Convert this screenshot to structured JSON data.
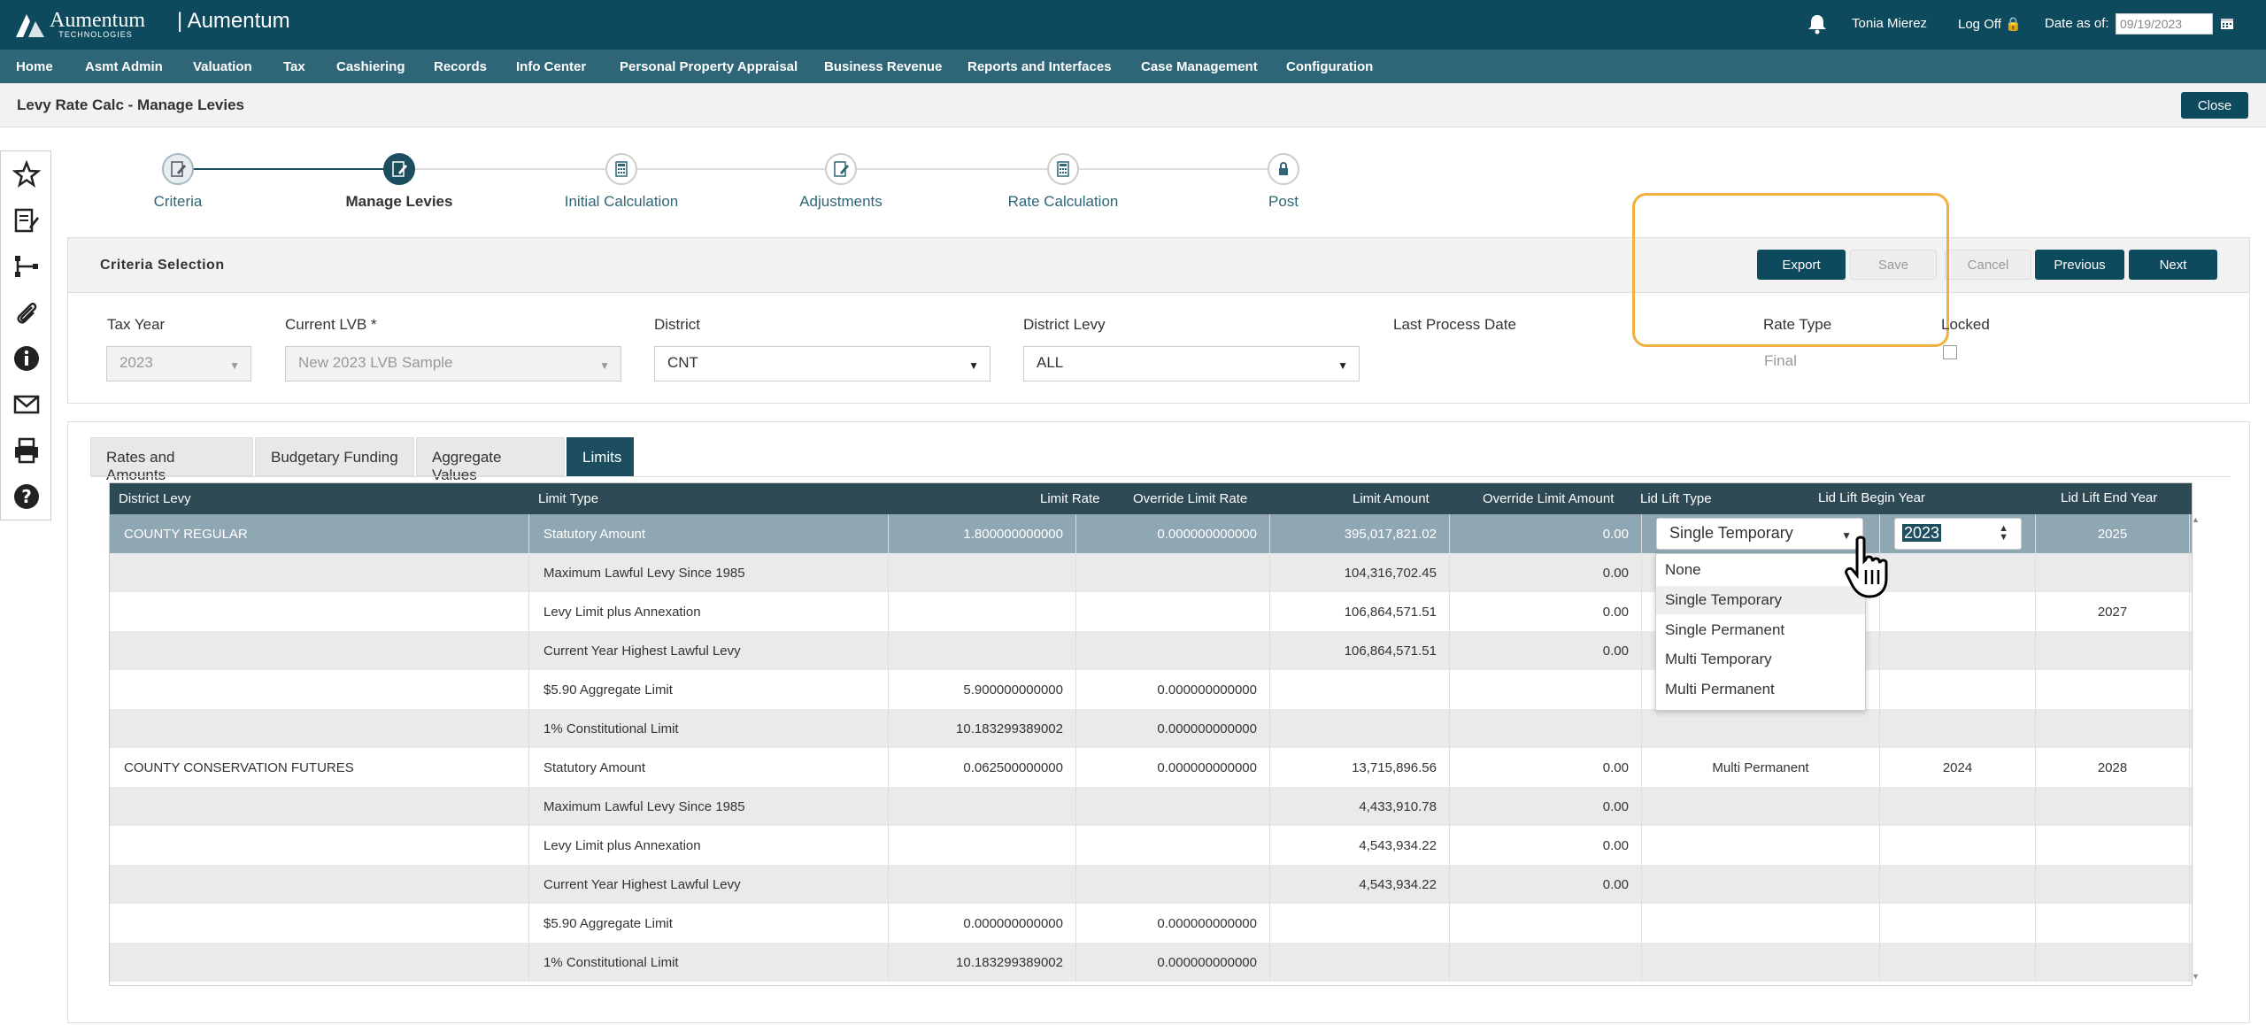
{
  "app": {
    "logo_text": "Aumentum",
    "logo_sub": "TECHNOLOGIES",
    "title": "| Aumentum",
    "user": "Tonia Mierez",
    "logoff": "Log Off",
    "date_label": "Date as of:",
    "date_value": "09/19/2023"
  },
  "menu": [
    "Home",
    "Asmt Admin",
    "Valuation",
    "Tax",
    "Cashiering",
    "Records",
    "Info Center",
    "Personal Property Appraisal",
    "Business Revenue",
    "Reports and Interfaces",
    "Case Management",
    "Configuration"
  ],
  "page": {
    "title": "Levy Rate Calc - Manage Levies",
    "close_label": "Close"
  },
  "sidebar_icons": [
    "star-icon",
    "edit-document-icon",
    "hierarchy-icon",
    "paperclip-icon",
    "info-icon",
    "mail-icon",
    "printer-icon",
    "help-icon"
  ],
  "steps": [
    {
      "label": "Criteria",
      "state": "done"
    },
    {
      "label": "Manage Levies",
      "state": "active"
    },
    {
      "label": "Initial Calculation",
      "state": "pending"
    },
    {
      "label": "Adjustments",
      "state": "pending"
    },
    {
      "label": "Rate Calculation",
      "state": "pending"
    },
    {
      "label": "Post",
      "state": "pending"
    }
  ],
  "criteria": {
    "title": "Criteria Selection",
    "buttons": {
      "export": "Export",
      "save": "Save",
      "cancel": "Cancel",
      "previous": "Previous",
      "next": "Next"
    },
    "fields": {
      "tax_year_label": "Tax Year",
      "tax_year_value": "2023",
      "lvb_label": "Current LVB *",
      "lvb_value": "New 2023 LVB Sample",
      "district_label": "District",
      "district_value": "CNT",
      "district_levy_label": "District Levy",
      "district_levy_value": "ALL",
      "last_process_label": "Last Process Date",
      "rate_type_label": "Rate Type",
      "rate_type_value": "Final",
      "locked_label": "Locked"
    }
  },
  "tabs": [
    "Rates and Amounts",
    "Budgetary Funding",
    "Aggregate Values",
    "Limits"
  ],
  "grid": {
    "columns": [
      "District Levy",
      "Limit Type",
      "Limit Rate",
      "Override Limit Rate",
      "Limit Amount",
      "Override Limit Amount",
      "Lid Lift Type",
      "Lid Lift Begin Year",
      "Lid Lift End Year"
    ],
    "rows": [
      [
        "COUNTY REGULAR",
        "Statutory Amount",
        "1.800000000000",
        "0.000000000000",
        "395,017,821.02",
        "0.00",
        "",
        "",
        "2025"
      ],
      [
        "",
        "Maximum Lawful Levy Since 1985",
        "",
        "",
        "104,316,702.45",
        "0.00",
        "",
        "",
        ""
      ],
      [
        "",
        "Levy Limit plus Annexation",
        "",
        "",
        "106,864,571.51",
        "0.00",
        "",
        "",
        "2027"
      ],
      [
        "",
        "Current Year Highest Lawful Levy",
        "",
        "",
        "106,864,571.51",
        "0.00",
        "",
        "",
        ""
      ],
      [
        "",
        "$5.90 Aggregate Limit",
        "5.900000000000",
        "0.000000000000",
        "",
        "",
        "",
        "",
        ""
      ],
      [
        "",
        "1% Constitutional Limit",
        "10.183299389002",
        "0.000000000000",
        "",
        "",
        "",
        "",
        ""
      ],
      [
        "COUNTY CONSERVATION FUTURES",
        "Statutory Amount",
        "0.062500000000",
        "0.000000000000",
        "13,715,896.56",
        "0.00",
        "Multi Permanent",
        "2024",
        "2028"
      ],
      [
        "",
        "Maximum Lawful Levy Since 1985",
        "",
        "",
        "4,433,910.78",
        "0.00",
        "",
        "",
        ""
      ],
      [
        "",
        "Levy Limit plus Annexation",
        "",
        "",
        "4,543,934.22",
        "0.00",
        "",
        "",
        ""
      ],
      [
        "",
        "Current Year Highest Lawful Levy",
        "",
        "",
        "4,543,934.22",
        "0.00",
        "",
        "",
        ""
      ],
      [
        "",
        "$5.90 Aggregate Limit",
        "0.000000000000",
        "0.000000000000",
        "",
        "",
        "",
        "",
        ""
      ],
      [
        "",
        "1% Constitutional Limit",
        "10.183299389002",
        "0.000000000000",
        "",
        "",
        "",
        "",
        ""
      ]
    ]
  },
  "lid_dropdown": {
    "selected": "Single Temporary",
    "options": [
      "None",
      "Single Temporary",
      "Single Permanent",
      "Multi Temporary",
      "Multi Permanent"
    ],
    "highlighted_index": 1
  },
  "begin_year_input": "2023"
}
